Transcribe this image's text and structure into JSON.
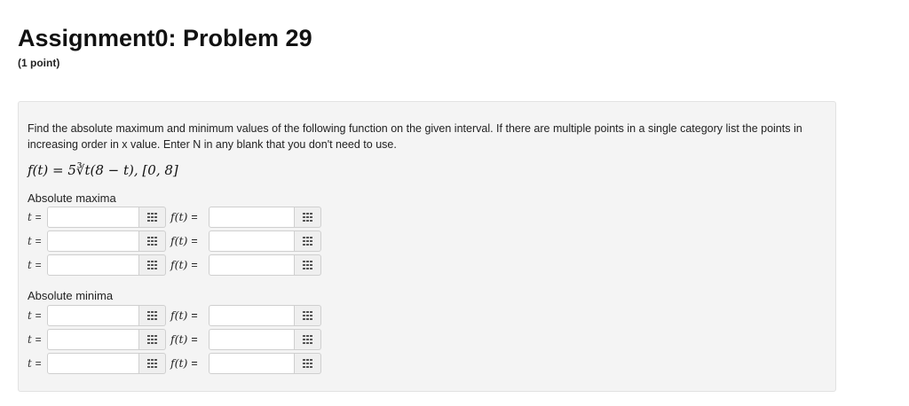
{
  "header": {
    "title": "Assignment0: Problem 29",
    "points": "(1 point)"
  },
  "problem": {
    "instructions": "Find the absolute maximum and minimum values of the following function on the given interval. If there are multiple points in a single category list the points in increasing order in x value. Enter N in any blank that you don't need to use.",
    "formula": "f(t) = 5∛t(8 − t),  [0, 8]",
    "t_label": "t",
    "f_label": "f(t)",
    "equals": "=",
    "max_label": "Absolute maxima",
    "min_label": "Absolute minima",
    "maxima": [
      {
        "t_value": "",
        "f_value": ""
      },
      {
        "t_value": "",
        "f_value": ""
      },
      {
        "t_value": "",
        "f_value": ""
      }
    ],
    "minima": [
      {
        "t_value": "",
        "f_value": ""
      },
      {
        "t_value": "",
        "f_value": ""
      },
      {
        "t_value": "",
        "f_value": ""
      }
    ],
    "palette_icon": "equation-palette-grid-icon"
  }
}
